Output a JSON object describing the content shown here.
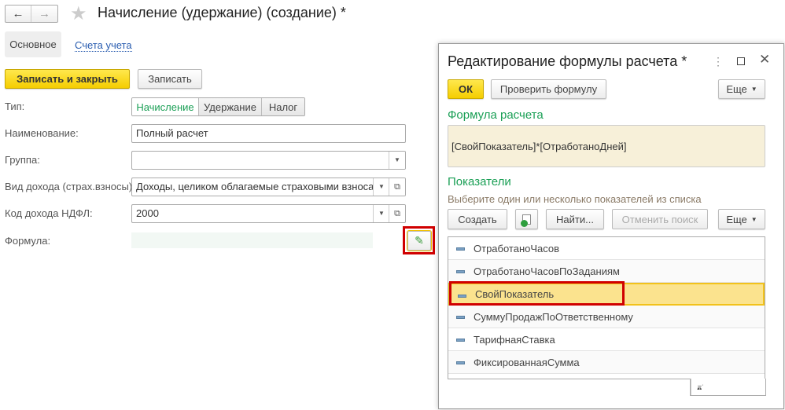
{
  "window": {
    "title": "Начисление (удержание) (создание) *"
  },
  "tabs": [
    {
      "label": "Основное",
      "active": true
    },
    {
      "label": "Счета учета",
      "active": false
    }
  ],
  "toolbar": {
    "save_close": "Записать и закрыть",
    "save": "Записать"
  },
  "form": {
    "type_label": "Тип:",
    "type_options": [
      "Начисление",
      "Удержание",
      "Налог"
    ],
    "type_selected": "Начисление",
    "name_label": "Наименование:",
    "name_value": "Полный расчет",
    "group_label": "Группа:",
    "group_value": "",
    "income_kind_label": "Вид дохода (страх.взносы):",
    "income_kind_value": "Доходы, целиком облагаемые страховыми взносами",
    "ndfl_label": "Код дохода НДФЛ:",
    "ndfl_value": "2000",
    "formula_label": "Формула:",
    "formula_value": ""
  },
  "dialog": {
    "title": "Редактирование формулы расчета *",
    "ok": "ОК",
    "check": "Проверить формулу",
    "more": "Еще",
    "formula_heading": "Формула расчета",
    "formula_text": "[СвойПоказатель]*[ОтработаноДней]",
    "indicators_heading": "Показатели",
    "indicators_hint": "Выберите один или несколько показателей из списка",
    "create": "Создать",
    "find": "Найти...",
    "cancel_search": "Отменить поиск",
    "more2": "Еще",
    "items": [
      "ОтработаноЧасов",
      "ОтработаноЧасовПоЗаданиям",
      "СвойПоказатель",
      "СуммуПродажПоОтветственному",
      "ТарифнаяСтавка",
      "ФиксированнаяСумма"
    ],
    "selected": "СвойПоказатель"
  },
  "colors": {
    "accent_green": "#1a9f55",
    "highlight_red": "#d00000",
    "selection": "#fbe38e"
  }
}
